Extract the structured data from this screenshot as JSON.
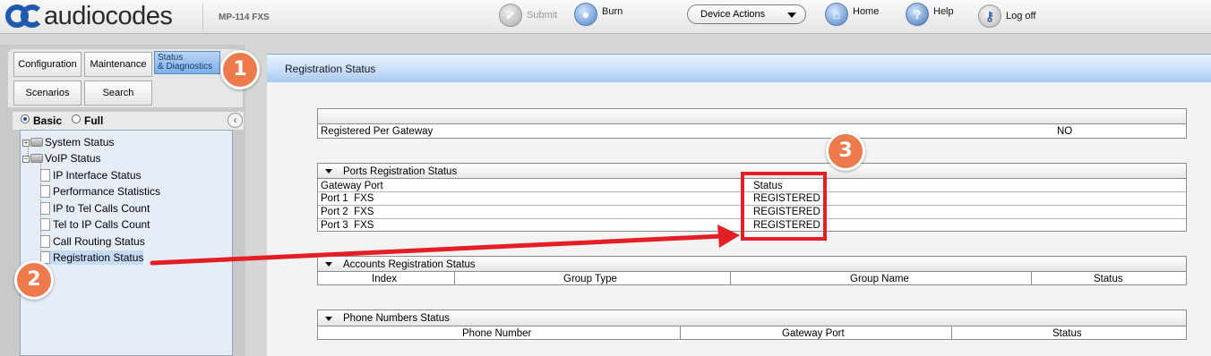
{
  "brand": {
    "logo_text": "audiocodes",
    "product": "MP-114 FXS",
    "colors": {
      "logo_blue": "#1f5ab0",
      "accent_orange": "#ec7a4c",
      "annotation_red": "#e31e24"
    }
  },
  "toolbar": {
    "submit": {
      "label": "Submit",
      "icon": "check-icon",
      "enabled": false
    },
    "burn": {
      "label": "Burn",
      "icon": "burn-icon"
    },
    "device_actions": {
      "label": "Device Actions",
      "icon": "chevron-down-icon"
    },
    "home": {
      "label": "Home",
      "icon": "home-icon"
    },
    "help": {
      "label": "Help",
      "icon": "help-icon"
    },
    "logoff": {
      "label": "Log off",
      "icon": "key-icon"
    }
  },
  "nav_tabs": {
    "configuration": "Configuration",
    "maintenance": "Maintenance",
    "status_line1": "Status",
    "status_line2": "& Diagnostics",
    "scenarios": "Scenarios",
    "search": "Search"
  },
  "view_mode": {
    "basic": "Basic",
    "full": "Full",
    "selected": "Basic"
  },
  "tree": {
    "system_status": "System Status",
    "voip_status": "VoIP Status",
    "items": [
      "IP Interface Status",
      "Performance Statistics",
      "IP to Tel Calls Count",
      "Tel to IP Calls Count",
      "Call Routing Status",
      "Registration Status"
    ],
    "selected": "Registration Status"
  },
  "page": {
    "title": "Registration Status",
    "gateway": {
      "label": "Registered Per Gateway",
      "value": "NO"
    },
    "ports": {
      "title": "Ports Registration Status",
      "columns": [
        "Gateway Port",
        "Status"
      ],
      "rows": [
        {
          "port": "Port 1  FXS",
          "status": "REGISTERED"
        },
        {
          "port": "Port 2  FXS",
          "status": "REGISTERED"
        },
        {
          "port": "Port 3  FXS",
          "status": "REGISTERED"
        }
      ]
    },
    "accounts": {
      "title": "Accounts Registration Status",
      "columns": [
        "Index",
        "Group Type",
        "Group Name",
        "Status"
      ]
    },
    "phones": {
      "title": "Phone Numbers Status",
      "columns": [
        "Phone Number",
        "Gateway Port",
        "Status"
      ]
    }
  },
  "callouts": {
    "c1": "1",
    "c2": "2",
    "c3": "3"
  }
}
